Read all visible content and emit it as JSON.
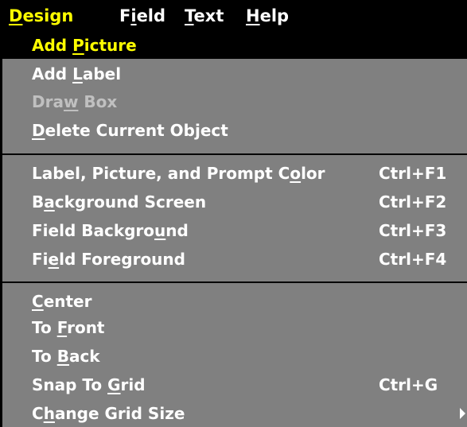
{
  "menubar": {
    "items": [
      {
        "pre": "",
        "key": "D",
        "post": "esign"
      },
      {
        "pre": "F",
        "key": "i",
        "post": "eld"
      },
      {
        "pre": "",
        "key": "T",
        "post": "ext"
      },
      {
        "pre": "",
        "key": "H",
        "post": "elp"
      }
    ]
  },
  "dropdown": {
    "items": [
      {
        "pre": "Add ",
        "key": "P",
        "post": "icture",
        "shortcut": ""
      },
      {
        "pre": "Add ",
        "key": "L",
        "post": "abel",
        "shortcut": ""
      },
      {
        "pre": "Dra",
        "key": "w",
        "post": " Box",
        "shortcut": ""
      },
      {
        "pre": "",
        "key": "D",
        "post": "elete Current Object",
        "shortcut": ""
      },
      {
        "pre": "Label, Picture, and Prompt C",
        "key": "o",
        "post": "lor",
        "shortcut": "Ctrl+F1"
      },
      {
        "pre": "B",
        "key": "a",
        "post": "ckground Screen",
        "shortcut": "Ctrl+F2"
      },
      {
        "pre": "Field Backgro",
        "key": "u",
        "post": "nd",
        "shortcut": "Ctrl+F3"
      },
      {
        "pre": "Fi",
        "key": "e",
        "post": "ld Foreground",
        "shortcut": "Ctrl+F4"
      },
      {
        "pre": "",
        "key": "C",
        "post": "enter",
        "shortcut": ""
      },
      {
        "pre": "To ",
        "key": "F",
        "post": "ront",
        "shortcut": ""
      },
      {
        "pre": "To ",
        "key": "B",
        "post": "ack",
        "shortcut": ""
      },
      {
        "pre": "Snap To ",
        "key": "G",
        "post": "rid",
        "shortcut": "Ctrl+G"
      },
      {
        "pre": "C",
        "key": "h",
        "post": "ange Grid Size",
        "shortcut": ""
      }
    ]
  },
  "colors": {
    "menubar_bg": "#000000",
    "menu_bg": "#808080",
    "text": "#ffffff",
    "highlight_text": "#ffff00",
    "disabled_text": "#c0c0c0"
  }
}
